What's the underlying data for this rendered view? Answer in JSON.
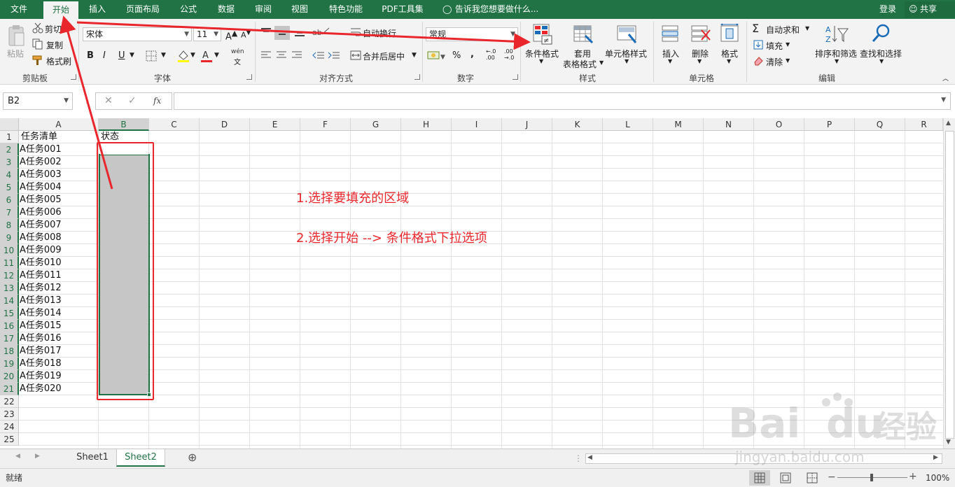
{
  "menu": {
    "tabs": [
      "文件",
      "开始",
      "插入",
      "页面布局",
      "公式",
      "数据",
      "审阅",
      "视图",
      "特色功能",
      "PDF工具集"
    ],
    "tell_me": "告诉我您想要做什么...",
    "login": "登录",
    "share": "共享"
  },
  "ribbon": {
    "clipboard": {
      "paste": "粘贴",
      "cut": "剪切",
      "copy": "复制",
      "format_painter": "格式刷",
      "label": "剪贴板"
    },
    "font": {
      "name": "宋体",
      "size": "11",
      "bold": "B",
      "italic": "I",
      "underline": "U",
      "label": "字体",
      "phonetic": "wén"
    },
    "alignment": {
      "wrap": "自动换行",
      "merge": "合并后居中",
      "label": "对齐方式"
    },
    "number": {
      "format": "常规",
      "percent": "%",
      "comma": ",",
      "label": "数字"
    },
    "styles": {
      "conditional": "条件格式",
      "table_format_1": "套用",
      "table_format_2": "表格格式",
      "cell_styles": "单元格样式",
      "label": "样式"
    },
    "cells": {
      "insert": "插入",
      "delete": "删除",
      "format": "格式",
      "label": "单元格"
    },
    "editing": {
      "autosum": "自动求和",
      "fill": "填充",
      "clear": "清除",
      "sort": "排序和筛选",
      "find": "查找和选择",
      "label": "编辑"
    }
  },
  "formula_bar": {
    "name_box": "B2",
    "fx": "fx",
    "value": ""
  },
  "sheet": {
    "columns": [
      "A",
      "B",
      "C",
      "D",
      "E",
      "F",
      "G",
      "H",
      "I",
      "J",
      "K",
      "L",
      "M",
      "N",
      "O",
      "P",
      "Q",
      "R"
    ],
    "rows": [
      "1",
      "2",
      "3",
      "4",
      "5",
      "6",
      "7",
      "8",
      "9",
      "10",
      "11",
      "12",
      "13",
      "14",
      "15",
      "16",
      "17",
      "18",
      "19",
      "20",
      "21",
      "22",
      "23",
      "24",
      "25"
    ],
    "header_a": "任务清单",
    "header_b": "状态",
    "tasks": [
      "A任务001",
      "A任务002",
      "A任务003",
      "A任务004",
      "A任务005",
      "A任务006",
      "A任务007",
      "A任务008",
      "A任务009",
      "A任务010",
      "A任务011",
      "A任务012",
      "A任务013",
      "A任务014",
      "A任务015",
      "A任务016",
      "A任务017",
      "A任务018",
      "A任务019",
      "A任务020"
    ]
  },
  "annotations": {
    "step1": "1.选择要填充的区域",
    "step2": "2.选择开始 --> 条件格式下拉选项",
    "color": "#e8262b"
  },
  "tabs": {
    "sheet1": "Sheet1",
    "sheet2": "Sheet2"
  },
  "status": {
    "ready": "就绪",
    "zoom": "100%"
  },
  "watermark": {
    "brand": "Baidu经验",
    "url": "jingyan.baidu.com"
  },
  "colors": {
    "excel_green": "#217346",
    "selection_gray": "#c6c6c6"
  }
}
